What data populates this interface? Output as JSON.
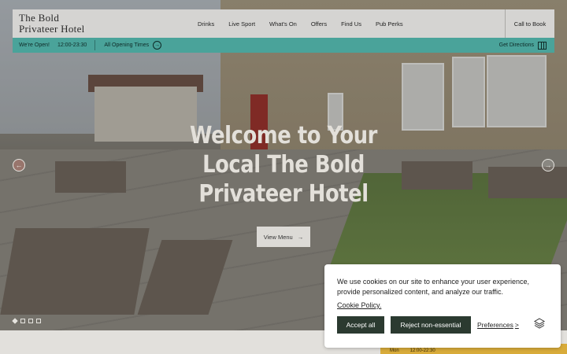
{
  "header": {
    "logo_line1": "The Bold",
    "logo_line2": "Privateer Hotel",
    "nav": [
      "Drinks",
      "Live Sport",
      "What's On",
      "Offers",
      "Find Us",
      "Pub Perks"
    ],
    "call": "Call to Book"
  },
  "info_bar": {
    "status": "We're Open!",
    "hours": "12:00-23:30",
    "all_hours": "All Opening Times",
    "directions": "Get Directions"
  },
  "hero": {
    "headline": "Welcome to Your Local The Bold Privateer Hotel",
    "cta": "View Menu"
  },
  "hours_card": {
    "day": "Mon",
    "time": "12:00-22:30"
  },
  "cookie": {
    "message": "We use cookies on our site to enhance your user experience, provide personalized content, and analyze our traffic.",
    "policy_link": "Cookie Policy.",
    "accept": "Accept all",
    "reject": "Reject non-essential",
    "preferences": "Preferences",
    "preferences_arrow": ">"
  },
  "icons": {
    "arrow": "→",
    "prev": "←",
    "next": "→"
  },
  "colors": {
    "teal": "#4aa39a",
    "dark_green": "#2b3a30",
    "mustard": "#d8ab3a"
  }
}
